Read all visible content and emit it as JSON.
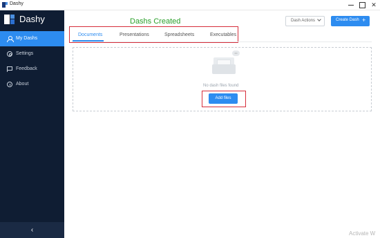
{
  "window": {
    "title": "Dashy",
    "controls": [
      "minimize",
      "maximize",
      "close"
    ],
    "close_glyph": "✕"
  },
  "sidebar": {
    "brand": "Dashy",
    "items": [
      {
        "label": "My Dashs",
        "icon": "user-icon",
        "active": true
      },
      {
        "label": "Settings",
        "icon": "gear-icon",
        "active": false
      },
      {
        "label": "Feedback",
        "icon": "flag-icon",
        "active": false
      },
      {
        "label": "About",
        "icon": "info-icon",
        "active": false
      }
    ],
    "collapse_glyph": "‹"
  },
  "main": {
    "heading": "Dashs Created",
    "actions_label": "Dash Actions",
    "create_label": "Create Dash",
    "create_glyph": "+",
    "tabs": [
      {
        "label": "Documents",
        "active": true
      },
      {
        "label": "Presentations",
        "active": false
      },
      {
        "label": "Spreadsheets",
        "active": false
      },
      {
        "label": "Executables",
        "active": false
      }
    ],
    "empty_text": "No dash files found",
    "add_label": "Add files",
    "bubble_text": "•••"
  },
  "watermark": "Activate W",
  "colors": {
    "accent": "#2d8cf0",
    "sidebar": "#0f1d33",
    "heading": "#2aa02a",
    "highlight": "#d62d3a"
  }
}
